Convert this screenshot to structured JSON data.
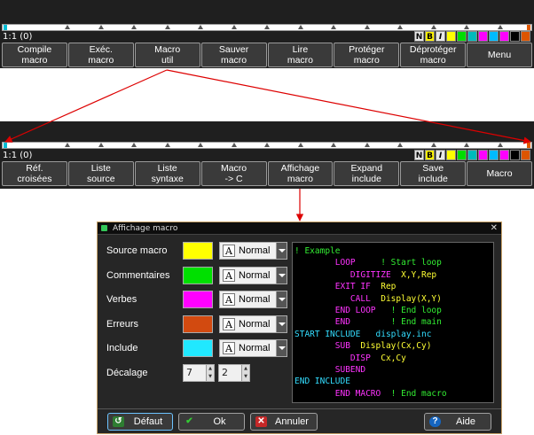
{
  "toolbar_top": {
    "status": "1:1 (0)",
    "buttons": [
      "Compile\nmacro",
      "Exéc.\nmacro",
      "Macro\nutil",
      "Sauver\nmacro",
      "Lire\nmacro",
      "Protéger\nmacro",
      "Déprotéger\nmacro",
      "Menu"
    ]
  },
  "toolbar_bottom": {
    "status": "1:1 (0)",
    "buttons": [
      "Réf.\ncroisées",
      "Liste\nsource",
      "Liste\nsyntaxe",
      "Macro\n-> C",
      "Affichage\nmacro",
      "Expand\ninclude",
      "Save\ninclude",
      "Macro"
    ]
  },
  "format_bar": {
    "labels": [
      "N",
      "B",
      "I"
    ],
    "colors": [
      "#ffff00",
      "#00dd00",
      "#00bbbb",
      "#ff00ff",
      "#00bbff",
      "#ff00ff",
      "#000000",
      "#dd5500"
    ]
  },
  "dialog": {
    "title": "Affichage macro",
    "close": "✕",
    "rows": [
      {
        "label": "Source macro",
        "color": "#ffff00",
        "style": "Normal"
      },
      {
        "label": "Commentaires",
        "color": "#00e000",
        "style": "Normal"
      },
      {
        "label": "Verbes",
        "color": "#ff00ff",
        "style": "Normal"
      },
      {
        "label": "Erreurs",
        "color": "#d24a10",
        "style": "Normal"
      },
      {
        "label": "Include",
        "color": "#20e8ff",
        "style": "Normal"
      }
    ],
    "offset": {
      "label": "Décalage",
      "value1": "7",
      "value2": "2"
    },
    "code_lines": [
      [
        {
          "t": "! Example",
          "c": "green"
        }
      ],
      [
        {
          "t": "        LOOP",
          "c": "magenta"
        },
        {
          "t": "     ! Start loop",
          "c": "green"
        }
      ],
      [
        {
          "t": "           DIGITIZE",
          "c": "magenta"
        },
        {
          "t": "  X,Y,Rep",
          "c": "yellow"
        }
      ],
      [
        {
          "t": "        EXIT IF",
          "c": "magenta"
        },
        {
          "t": "  Rep",
          "c": "yellow"
        }
      ],
      [
        {
          "t": "           CALL",
          "c": "magenta"
        },
        {
          "t": "  Display(X,Y)",
          "c": "yellow"
        }
      ],
      [
        {
          "t": "        END LOOP",
          "c": "magenta"
        },
        {
          "t": "   ! End loop",
          "c": "green"
        }
      ],
      [
        {
          "t": "        END",
          "c": "magenta"
        },
        {
          "t": "        ! End main",
          "c": "green"
        }
      ],
      [
        {
          "t": "START INCLUDE",
          "c": "cyan"
        },
        {
          "t": "   display.inc",
          "c": "cyan"
        }
      ],
      [
        {
          "t": "        SUB",
          "c": "magenta"
        },
        {
          "t": "  Display(Cx,Cy)",
          "c": "yellow"
        }
      ],
      [
        {
          "t": "           DISP",
          "c": "magenta"
        },
        {
          "t": "  Cx,Cy",
          "c": "yellow"
        }
      ],
      [
        {
          "t": "        SUBEND",
          "c": "magenta"
        }
      ],
      [
        {
          "t": "END INCLUDE",
          "c": "cyan"
        }
      ],
      [
        {
          "t": "        END MACRO",
          "c": "magenta"
        },
        {
          "t": "  ! End macro",
          "c": "green"
        }
      ]
    ],
    "buttons": {
      "default": "Défaut",
      "ok": "Ok",
      "cancel": "Annuler",
      "help": "Aide"
    }
  }
}
